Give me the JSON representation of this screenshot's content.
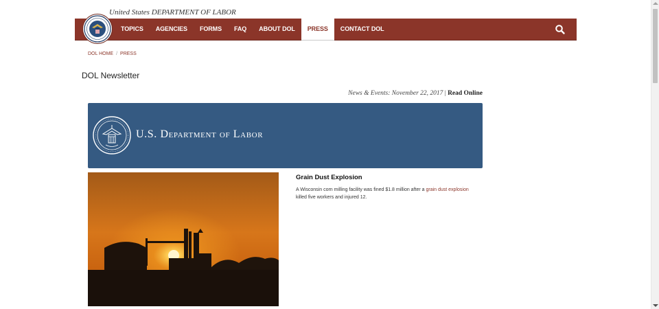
{
  "header": {
    "agency_title": "United States DEPARTMENT OF LABOR",
    "nav": [
      {
        "label": "TOPICS"
      },
      {
        "label": "AGENCIES"
      },
      {
        "label": "FORMS"
      },
      {
        "label": "FAQ"
      },
      {
        "label": "ABOUT DOL"
      },
      {
        "label": "PRESS",
        "active": true
      },
      {
        "label": "CONTACT DOL"
      }
    ],
    "search_icon": "search-icon"
  },
  "breadcrumb": {
    "home": "DOL HOME",
    "separator": "/",
    "current": "PRESS"
  },
  "page_title": "DOL Newsletter",
  "newsline": {
    "prefix": "News & Events: November 22, 2017",
    "separator": "|",
    "read_online": "Read Online"
  },
  "banner": {
    "text": "U.S. Department of Labor"
  },
  "article": {
    "title": "Grain Dust Explosion",
    "body_before": "A Wisconsin corn milling facility was fined $1.8 million after a ",
    "link_text": "grain dust explosion",
    "body_after": " killed five workers and injured 12."
  },
  "colors": {
    "nav_bg": "#8b3529",
    "banner_bg": "#355a82",
    "link": "#8b3529"
  }
}
